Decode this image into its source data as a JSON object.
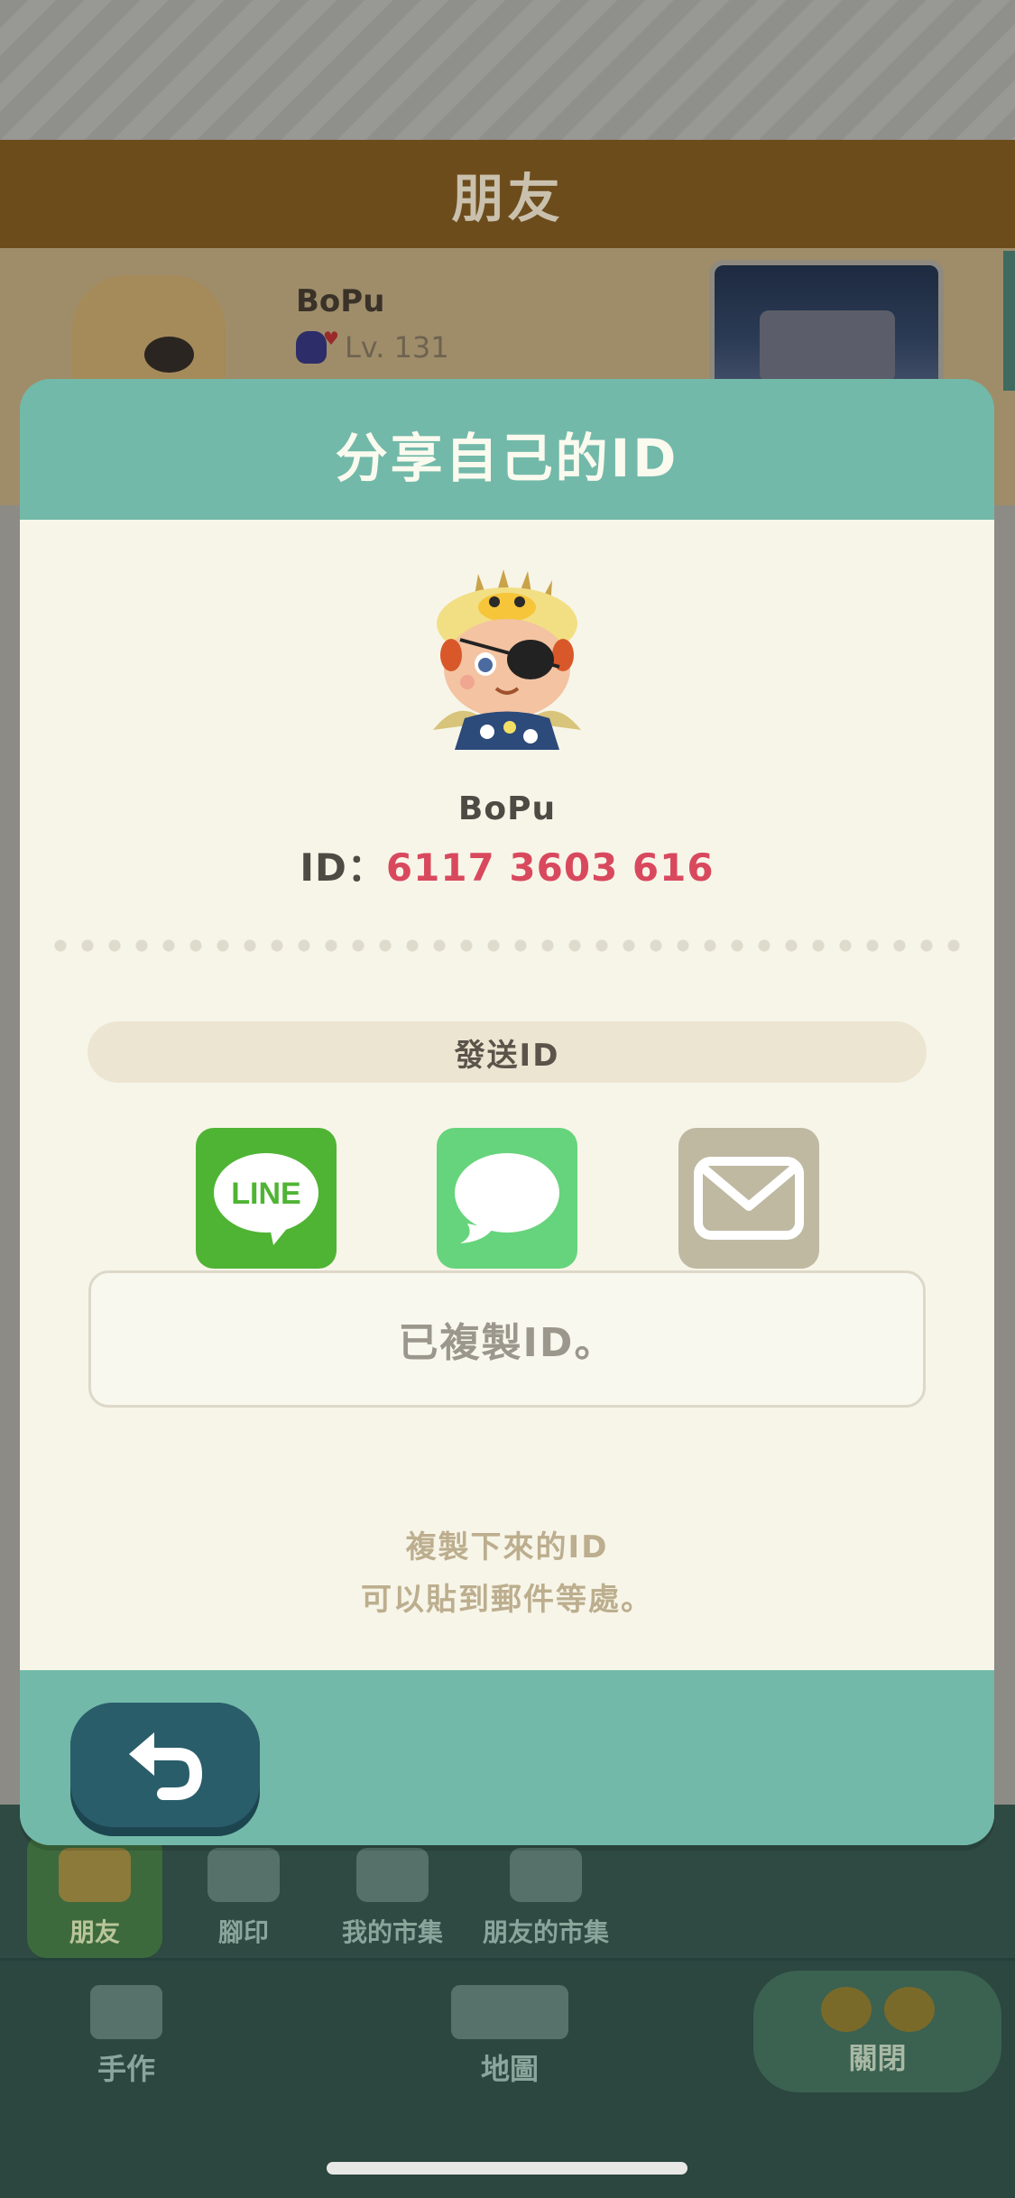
{
  "background": {
    "header_title": "朋友",
    "friend": {
      "name": "BoPu",
      "level": "Lv. 131"
    },
    "tabs": [
      {
        "label": "朋友",
        "icon": "friends-icon",
        "active": true
      },
      {
        "label": "腳印",
        "icon": "footprints-icon",
        "active": false
      },
      {
        "label": "我的市集",
        "icon": "market-stall-icon",
        "active": false
      },
      {
        "label": "朋友的市集",
        "icon": "friends-market-icon",
        "active": false
      }
    ],
    "nav": {
      "craft_label": "手作",
      "map_label": "地圖",
      "close_label": "關閉"
    }
  },
  "modal": {
    "title": "分享自己的ID",
    "user": {
      "name": "BoPu",
      "id_label": "ID：",
      "id_value": "6117 3603 616"
    },
    "send_section_label": "發送ID",
    "share_options": [
      {
        "name": "line",
        "icon": "line-icon",
        "text": "LINE",
        "color": "#4fb434"
      },
      {
        "name": "messages",
        "icon": "message-bubble-icon",
        "color": "#66d47c"
      },
      {
        "name": "mail",
        "icon": "mail-icon",
        "color": "#bfb9a2"
      }
    ],
    "copy_status": "已複製ID。",
    "hint_line1": "複製下來的ID",
    "hint_line2": "可以貼到郵件等處。",
    "back_icon": "back-arrow-icon"
  },
  "colors": {
    "modal_header": "#72b9a9",
    "modal_body": "#f7f5e8",
    "id_value": "#d9495e",
    "back_button": "#2a5d6a"
  }
}
